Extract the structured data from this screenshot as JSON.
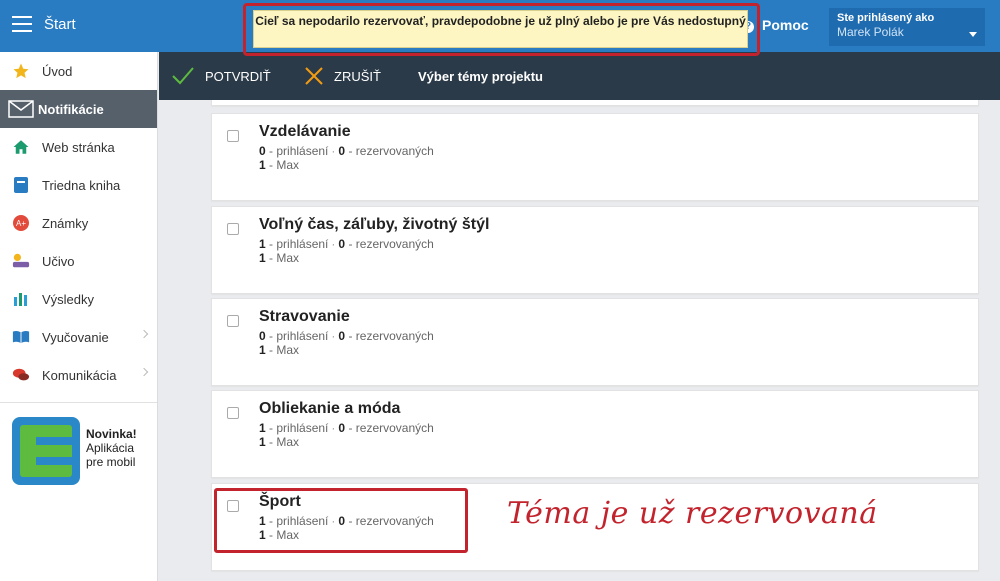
{
  "topbar": {
    "start_label": "Štart",
    "help_label": "Pomoc",
    "user_caption": "Ste prihlásený ako",
    "user_name": "Marek Polák"
  },
  "toast": {
    "message": "Cieľ sa nepodarilo rezervovať, pravdepodobne je už plný alebo je pre Vás nedostupný"
  },
  "sidebar": {
    "items": [
      {
        "label": "Úvod",
        "icon": "star-icon",
        "color": "#f2b51b"
      },
      {
        "label": "Notifikácie",
        "icon": "envelope-icon",
        "color": "#ffffff"
      },
      {
        "label": "Web stránka",
        "icon": "home-icon",
        "color": "#1c9c6e"
      },
      {
        "label": "Triedna kniha",
        "icon": "book-icon",
        "color": "#2a7cc2"
      },
      {
        "label": "Známky",
        "icon": "grade-icon",
        "color": "#e24b3b"
      },
      {
        "label": "Učivo",
        "icon": "teacher-icon",
        "color": "#f2b51b"
      },
      {
        "label": "Výsledky",
        "icon": "bar-chart-icon",
        "color": "#2a9fd6"
      },
      {
        "label": "Vyučovanie",
        "icon": "open-book-icon",
        "color": "#2a7cc2"
      },
      {
        "label": "Komunikácia",
        "icon": "chat-icon",
        "color": "#d9382c"
      }
    ],
    "promo": {
      "title": "Novinka!",
      "line1": "Aplikácia",
      "line2": "pre mobil"
    }
  },
  "toolbar": {
    "confirm_label": "POTVRDIŤ",
    "cancel_label": "ZRUŠIŤ",
    "title": "Výber témy projektu"
  },
  "topics": [
    {
      "name": "Vzdelávanie",
      "signed": "0",
      "reserved": "0",
      "max": "1"
    },
    {
      "name": "Voľný čas, záľuby, životný štýl",
      "signed": "1",
      "reserved": "0",
      "max": "1"
    },
    {
      "name": "Stravovanie",
      "signed": "0",
      "reserved": "0",
      "max": "1"
    },
    {
      "name": "Obliekanie a móda",
      "signed": "1",
      "reserved": "0",
      "max": "1"
    },
    {
      "name": "Šport",
      "signed": "1",
      "reserved": "0",
      "max": "1"
    }
  ],
  "labels": {
    "signed": "- prihlásení",
    "reserved": "- rezervovaných",
    "max": "- Max"
  },
  "annotation": "Téma je už rezervovaná",
  "colors": {
    "topbar": "#2a7cc2",
    "toolbar": "#2b3a48",
    "highlight": "#c2232c",
    "toast_bg": "#fdf6c3"
  }
}
